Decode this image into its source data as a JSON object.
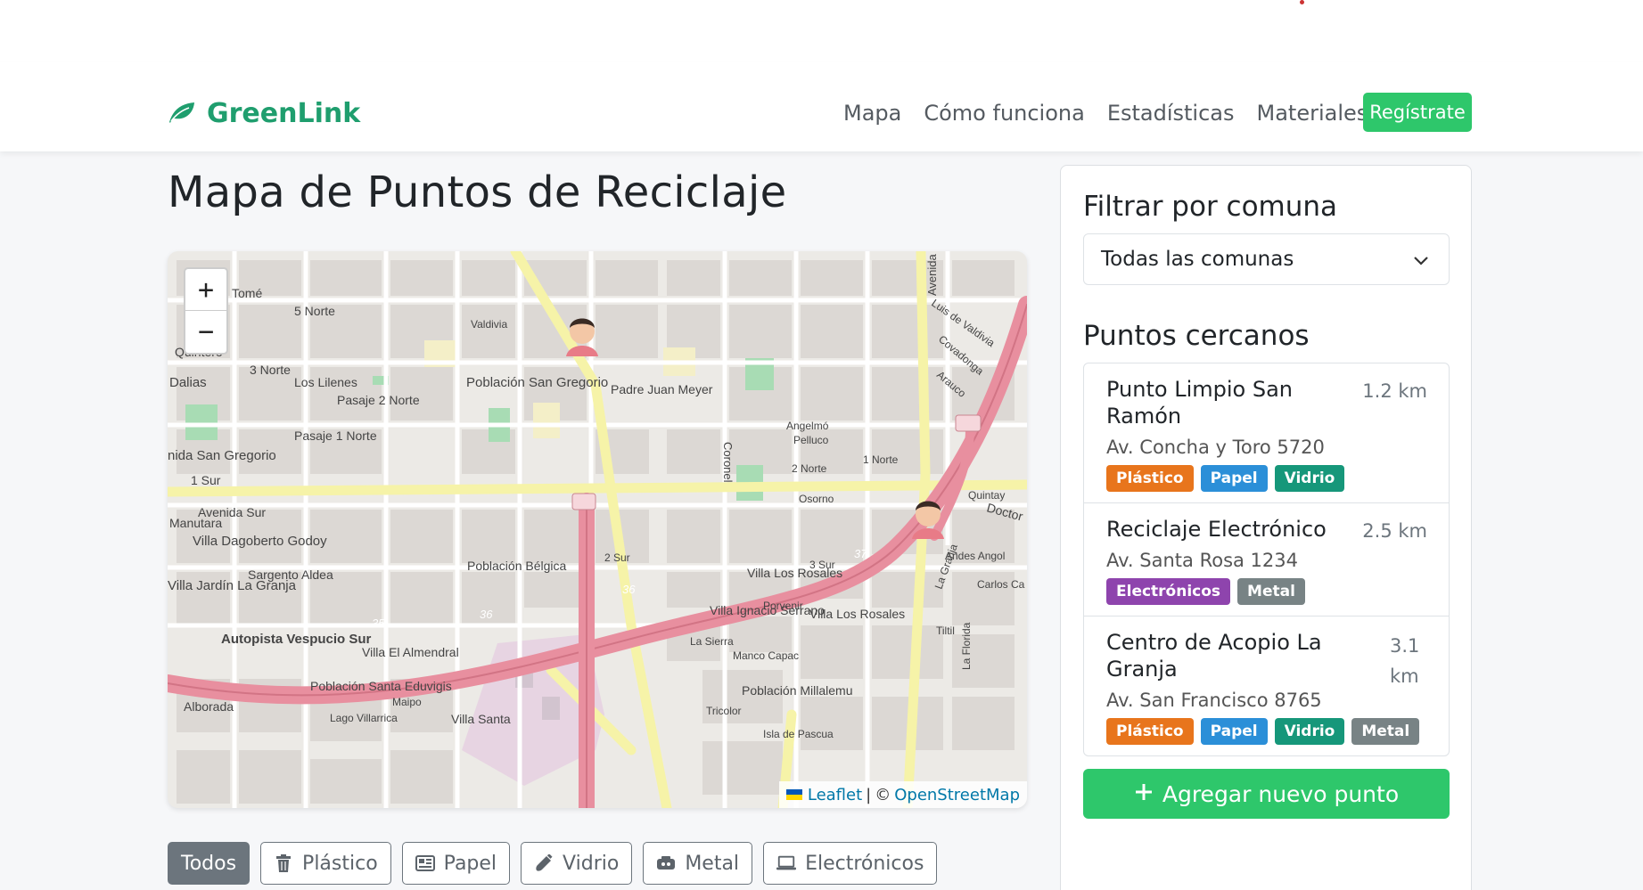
{
  "brand": {
    "name": "GreenLink",
    "color": "#1f9e6e"
  },
  "nav": {
    "links": [
      "Mapa",
      "Cómo funciona",
      "Estadísticas",
      "Materiales"
    ],
    "register": "Regístrate"
  },
  "page": {
    "title": "Mapa de Puntos de Reciclaje"
  },
  "map": {
    "zoom_in": "+",
    "zoom_out": "−",
    "attribution": {
      "leaflet": "Leaflet",
      "separator": "|",
      "copyright": "©",
      "osm": "OpenStreetMap"
    },
    "labels": [
      "Tomé",
      "5 Norte",
      "Quintero",
      "Dalias",
      "3 Norte",
      "Los Lilenes",
      "Pasaje 2 Norte",
      "Pasaje 1 Norte",
      "Población San Gregorio",
      "Padre Juan Meyer",
      "nida San Gregorio",
      "1 Sur",
      "Avenida Sur",
      "Manutara",
      "Villa Dagoberto Godoy",
      "Sargento Aldea",
      "Villa Jardín La Granja",
      "Autopista Vespucio Sur",
      "Villa El Almendral",
      "Población Santa Eduvigis",
      "Alborada",
      "Villa Santa",
      "Población Bélgica",
      "Villa Ignacio Serrano",
      "La Sierra",
      "Manco Capac",
      "Población Millalemu",
      "Villa Los Rosales",
      "Villa Los Rosales",
      "Carlos Ca",
      "Andes Angol",
      "Quintay",
      "Osorno",
      "Valdivia",
      "Angelmó",
      "Pelluco",
      "Coronel",
      "Luis de Valdivia",
      "Covadonga",
      "Arauco",
      "Doctor",
      "Avenida",
      "La Granja",
      "2 Norte",
      "1 Norte",
      "3 Sur",
      "2 Sur",
      "Porvenir",
      "Isla de Pascua",
      "Tricolor",
      "Lago Villarrica",
      "Maipo",
      "35",
      "36",
      "36",
      "37",
      "79",
      "70",
      "Tiltil",
      "La Florida"
    ],
    "markers": [
      "user-marker",
      "user-marker"
    ]
  },
  "filters": [
    {
      "label": "Todos",
      "icon": "none",
      "active": true
    },
    {
      "label": "Plástico",
      "icon": "trash-icon",
      "active": false
    },
    {
      "label": "Papel",
      "icon": "newspaper-icon",
      "active": false
    },
    {
      "label": "Vidrio",
      "icon": "bottle-icon",
      "active": false
    },
    {
      "label": "Metal",
      "icon": "can-icon",
      "active": false
    },
    {
      "label": "Electrónicos",
      "icon": "laptop-icon",
      "active": false
    }
  ],
  "sidebar": {
    "filter_title": "Filtrar por comuna",
    "select_value": "Todas las comunas",
    "nearby_title": "Puntos cercanos",
    "points": [
      {
        "name": "Punto Limpio San Ramón",
        "distance": "1.2 km",
        "address": "Av. Concha y Toro 5720",
        "tags": [
          "Plástico",
          "Papel",
          "Vidrio"
        ]
      },
      {
        "name": "Reciclaje Electrónico",
        "distance": "2.5 km",
        "address": "Av. Santa Rosa 1234",
        "tags": [
          "Electrónicos",
          "Metal"
        ]
      },
      {
        "name": "Centro de Acopio La Granja",
        "distance": "3.1 km",
        "address": "Av. San Francisco 8765",
        "tags": [
          "Plástico",
          "Papel",
          "Vidrio",
          "Metal"
        ]
      }
    ],
    "add_button": "Agregar nuevo punto"
  },
  "tag_colors": {
    "Plástico": "#e8751c",
    "Papel": "#2b8fd8",
    "Vidrio": "#16977a",
    "Metal": "#788385",
    "Electrónicos": "#8e44ad"
  }
}
